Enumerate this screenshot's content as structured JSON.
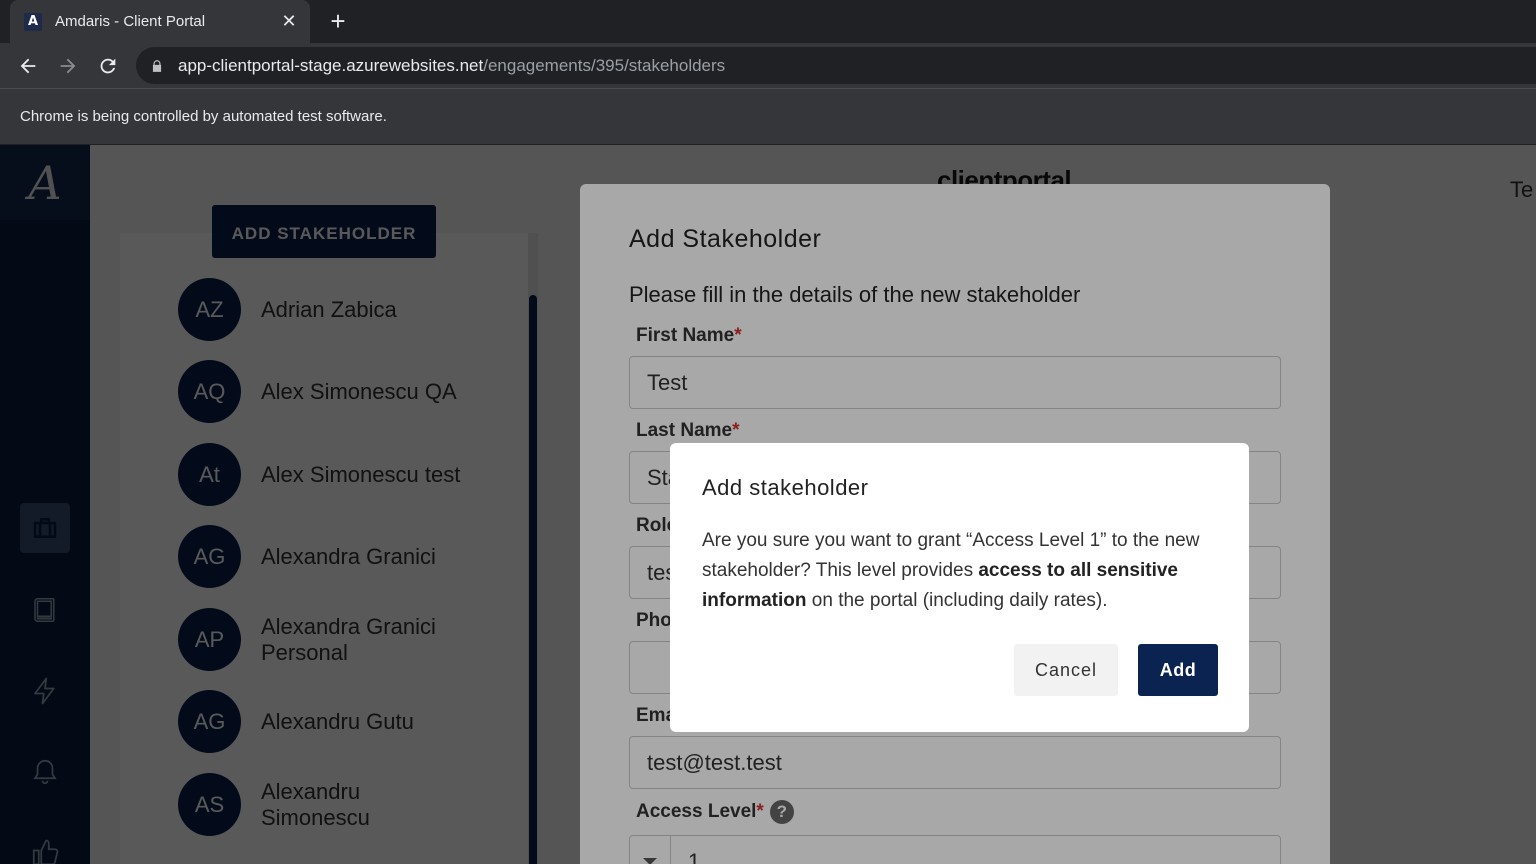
{
  "browser": {
    "tab_title": "Amdaris - Client Portal",
    "tab_close": "✕",
    "new_tab": "+",
    "favicon_letter": "A",
    "url_host": "app-clientportal-stage.azurewebsites.net",
    "url_path": "/engagements/395/stakeholders",
    "infobar_text": "Chrome is being controlled by automated test software."
  },
  "app": {
    "logo_letter": "A",
    "header_logo": "clientportal",
    "header_user": "Te",
    "add_stakeholder_label": "ADD STAKEHOLDER",
    "sidebar_icons": [
      "briefcase-icon",
      "book-icon",
      "lightning-icon",
      "bell-icon",
      "thumbs-up-icon"
    ],
    "stakeholders": [
      {
        "initials": "AZ",
        "name": "Adrian Zabica"
      },
      {
        "initials": "AQ",
        "name": "Alex Simonescu QA"
      },
      {
        "initials": "At",
        "name": "Alex Simonescu test"
      },
      {
        "initials": "AG",
        "name": "Alexandra Granici"
      },
      {
        "initials": "AP",
        "name": "Alexandra Granici Personal"
      },
      {
        "initials": "AG",
        "name": "Alexandru Gutu"
      },
      {
        "initials": "AS",
        "name": "Alexandru Simonescu"
      }
    ]
  },
  "form_dialog": {
    "title": "Add Stakeholder",
    "subtitle": "Please fill in the details of the new stakeholder",
    "required_mark": "*",
    "first_name_label": "First Name",
    "first_name_value": "Test",
    "last_name_label": "Last Name",
    "last_name_value": "Sta",
    "role_label": "Role",
    "role_value": "tes",
    "phone_label": "Pho",
    "phone_value": "",
    "email_label": "Ema",
    "email_value": "test@test.test",
    "access_level_label": "Access Level",
    "access_level_help": "?",
    "access_level_value": "1"
  },
  "confirm_dialog": {
    "title": "Add stakeholder",
    "text_before": "Are you sure you want to grant “Access Level 1” to the new stakeholder? This level provides ",
    "text_bold": "access to all sensitive information",
    "text_after": " on the portal (including daily rates).",
    "cancel_label": "Cancel",
    "add_label": "Add"
  },
  "colors": {
    "brand_navy": "#0b2350",
    "sidebar_bg": "#0b1c3d",
    "required": "#d32f2f"
  }
}
